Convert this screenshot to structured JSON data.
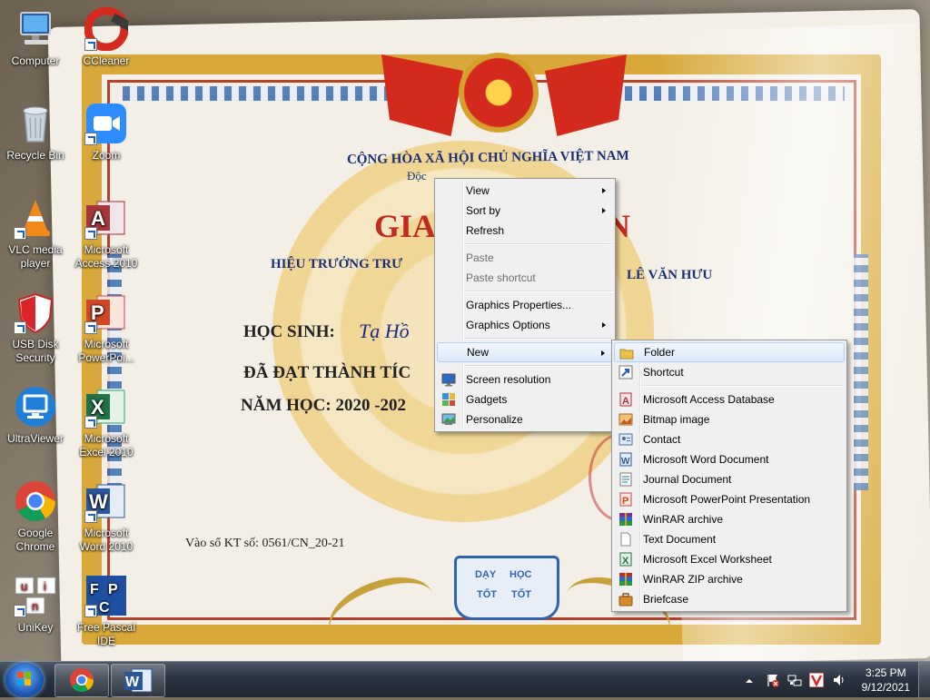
{
  "desktop": {
    "icons": [
      {
        "label": "Computer"
      },
      {
        "label": "CCleaner"
      },
      {
        "label": "Recycle Bin"
      },
      {
        "label": "Zoom"
      },
      {
        "label": "VLC media player"
      },
      {
        "label": "Microsoft Access 2010"
      },
      {
        "label": "USB Disk Security"
      },
      {
        "label": "Microsoft PowerPoi..."
      },
      {
        "label": "UltraViewer"
      },
      {
        "label": "Microsoft Excel 2010"
      },
      {
        "label": "Google Chrome"
      },
      {
        "label": "Microsoft Word 2010"
      },
      {
        "label": "UniKey"
      },
      {
        "label": "Free Pascal IDE"
      }
    ]
  },
  "wallpaper": {
    "republic": "CỘNG HÒA XÃ HỘI CHỦ NGHĨA VIỆT NAM",
    "motto": "Độc",
    "title": "GIA",
    "title_end": "N",
    "principal_left": "HIỆU TRƯỞNG TRƯ",
    "principal_right": "LÊ VĂN HƯU",
    "student_label": "HỌC SINH:",
    "student_name": "Tạ Hồ",
    "achievement": "ĐÃ ĐẠT THÀNH TÍC",
    "school_year": "NĂM HỌC: 2020 -202",
    "register_no": "Vào sổ KT số:  0561/CN_20-21",
    "book_words": [
      "DẠY",
      "HỌC",
      "TỐT",
      "TỐT"
    ]
  },
  "context_menu": {
    "items": [
      {
        "label": "View",
        "submenu": true
      },
      {
        "label": "Sort by",
        "submenu": true
      },
      {
        "label": "Refresh"
      },
      {
        "label": "Paste",
        "disabled": true
      },
      {
        "label": "Paste shortcut",
        "disabled": true
      },
      {
        "label": "Graphics Properties..."
      },
      {
        "label": "Graphics Options",
        "submenu": true
      },
      {
        "label": "New",
        "submenu": true,
        "highlighted": true
      },
      {
        "label": "Screen resolution",
        "icon": "screen-resolution-icon"
      },
      {
        "label": "Gadgets",
        "icon": "gadgets-icon"
      },
      {
        "label": "Personalize",
        "icon": "personalize-icon"
      }
    ]
  },
  "new_submenu": {
    "items": [
      {
        "label": "Folder",
        "icon": "folder-icon",
        "highlighted": true
      },
      {
        "label": "Shortcut",
        "icon": "shortcut-icon"
      },
      {
        "label": "Microsoft Access Database",
        "icon": "access-icon"
      },
      {
        "label": "Bitmap image",
        "icon": "bitmap-icon"
      },
      {
        "label": "Contact",
        "icon": "contact-icon"
      },
      {
        "label": "Microsoft Word Document",
        "icon": "word-icon"
      },
      {
        "label": "Journal Document",
        "icon": "journal-icon"
      },
      {
        "label": "Microsoft PowerPoint Presentation",
        "icon": "powerpoint-icon"
      },
      {
        "label": "WinRAR archive",
        "icon": "winrar-icon"
      },
      {
        "label": "Text Document",
        "icon": "text-document-icon"
      },
      {
        "label": "Microsoft Excel Worksheet",
        "icon": "excel-icon"
      },
      {
        "label": "WinRAR ZIP archive",
        "icon": "winrar-zip-icon"
      },
      {
        "label": "Briefcase",
        "icon": "briefcase-icon"
      }
    ]
  },
  "taskbar": {
    "pinned": [
      "chrome-icon",
      "word-icon"
    ],
    "clock": {
      "time": "3:25 PM",
      "date": "9/12/2021"
    }
  },
  "colors": {
    "menu_bg": "#f0f0f0",
    "highlight": "#dbe9f9",
    "taskbar": "#2b3441"
  }
}
